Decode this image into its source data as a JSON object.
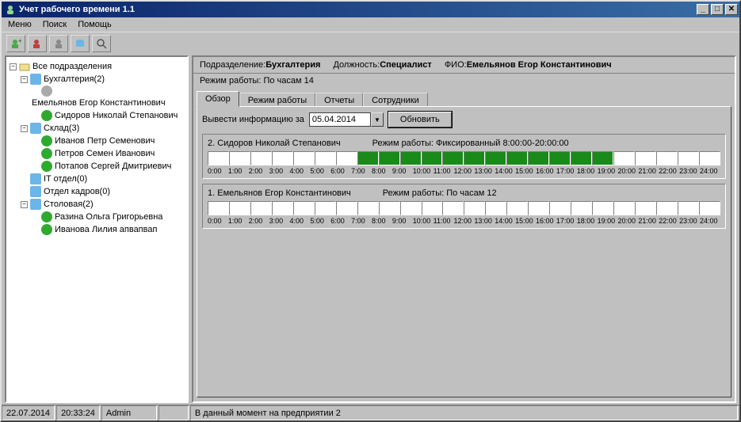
{
  "title": "Учет рабочего времени 1.1",
  "menu": {
    "m1": "Меню",
    "m2": "Поиск",
    "m3": "Помощь"
  },
  "tree": {
    "root": "Все подразделения",
    "dept1": "Бухгалтерия(2)",
    "dept1_emp1": "Емельянов Егор Константинович",
    "dept1_emp2": "Сидоров Николай Степанович",
    "dept2": "Склад(3)",
    "dept2_emp1": "Иванов Петр Семенович",
    "dept2_emp2": "Петров Семен Иванович",
    "dept2_emp3": "Потапов Сергей Дмитриевич",
    "dept3": "IT отдел(0)",
    "dept4": "Отдел кадров(0)",
    "dept5": "Столовая(2)",
    "dept5_emp1": "Разина Ольга Григорьевна",
    "dept5_emp2": "Иванова Лилия апвапвап"
  },
  "header": {
    "dept_label": "Подразделение:",
    "dept_value": "Бухгалтерия",
    "pos_label": "Должность:",
    "pos_value": "Специалист",
    "fio_label": "ФИО:",
    "fio_value": "Емельянов Егор Константинович",
    "mode_label": "Режим работы:",
    "mode_value": "По часам   14"
  },
  "tabs": {
    "t1": "Обзор",
    "t2": "Режим работы",
    "t3": "Отчеты",
    "t4": "Сотрудники"
  },
  "filter": {
    "label": "Вывести информацию за",
    "date": "05.04.2014",
    "refresh": "Обновить"
  },
  "emp1": {
    "name": "2. Сидоров Николай Степанович",
    "mode": "Режим работы: Фиксированный   8:00:00-20:00:00",
    "fill_start": 7,
    "fill_end": 19
  },
  "emp2": {
    "name": "1. Емельянов Егор Константинович",
    "mode": "Режим работы: По часам   12"
  },
  "hours": [
    "0:00",
    "1:00",
    "2:00",
    "3:00",
    "4:00",
    "5:00",
    "6:00",
    "7:00",
    "8:00",
    "9:00",
    "10:00",
    "11:00",
    "12:00",
    "13:00",
    "14:00",
    "15:00",
    "16:00",
    "17:00",
    "18:00",
    "19:00",
    "20:00",
    "21:00",
    "22:00",
    "23:00",
    "24:00"
  ],
  "status": {
    "date": "22.07.2014",
    "time": "20:33:24",
    "user": "Admin",
    "msg": "В данный момент на предприятии 2"
  }
}
